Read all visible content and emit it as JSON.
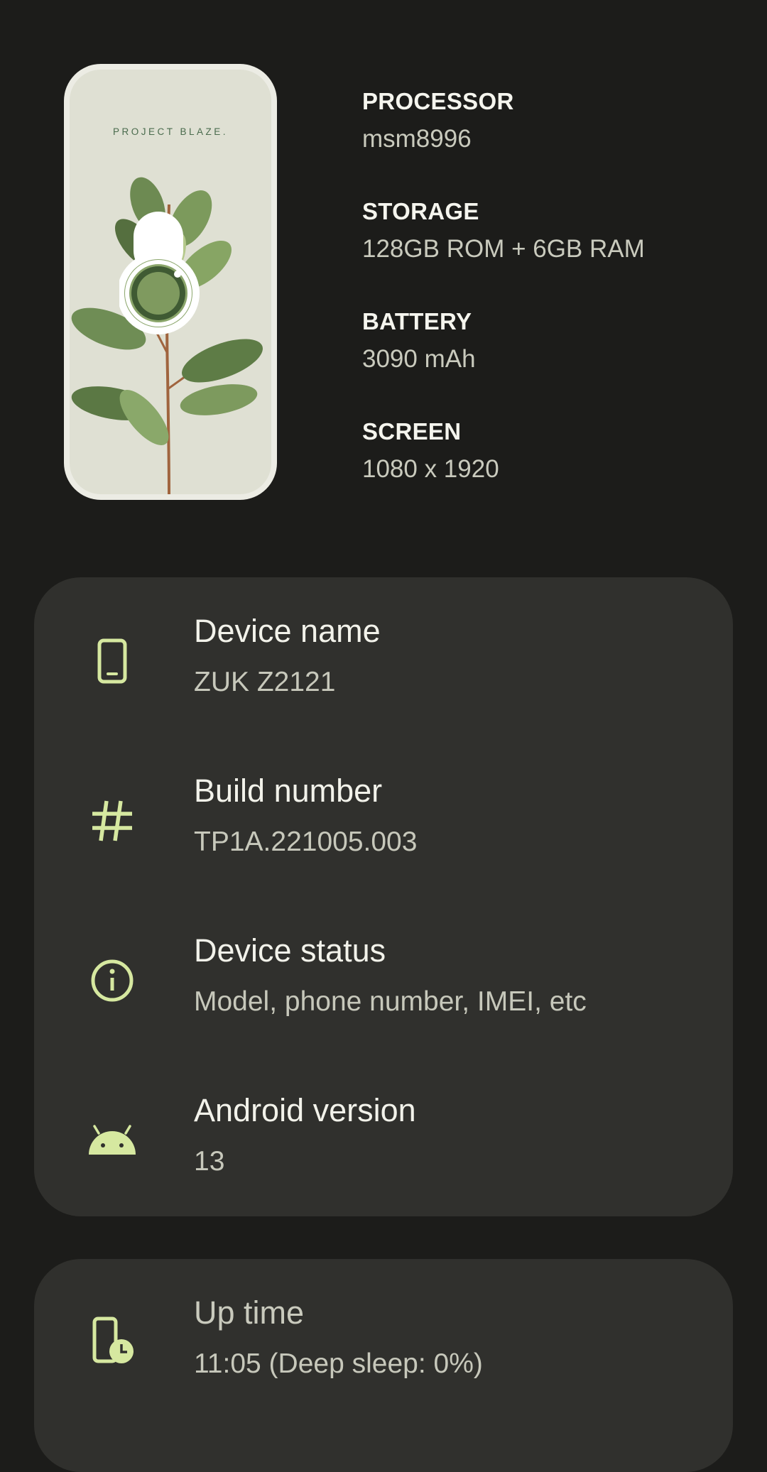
{
  "hero": {
    "brand": "PROJECT BLAZE."
  },
  "specs": [
    {
      "label": "PROCESSOR",
      "value": "msm8996"
    },
    {
      "label": "STORAGE",
      "value": "128GB ROM + 6GB RAM"
    },
    {
      "label": "BATTERY",
      "value": "3090 mAh"
    },
    {
      "label": "SCREEN",
      "value": "1080 x 1920"
    }
  ],
  "rows": [
    {
      "title": "Device name",
      "subtitle": "ZUK Z2121",
      "icon": "smartphone-icon"
    },
    {
      "title": "Build number",
      "subtitle": "TP1A.221005.003",
      "icon": "hash-icon"
    },
    {
      "title": "Device status",
      "subtitle": "Model, phone number, IMEI, etc",
      "icon": "info-icon"
    },
    {
      "title": "Android version",
      "subtitle": "13",
      "icon": "android-icon"
    }
  ],
  "uptime": {
    "title": "Up time",
    "subtitle": "11:05 (Deep sleep: 0%)",
    "icon": "phone-clock-icon"
  },
  "colors": {
    "background": "#1c1c1a",
    "card": "#30302d",
    "accent": "#d6e8a0",
    "text_primary": "#f2f2ea",
    "text_secondary": "#c7c8bb"
  }
}
